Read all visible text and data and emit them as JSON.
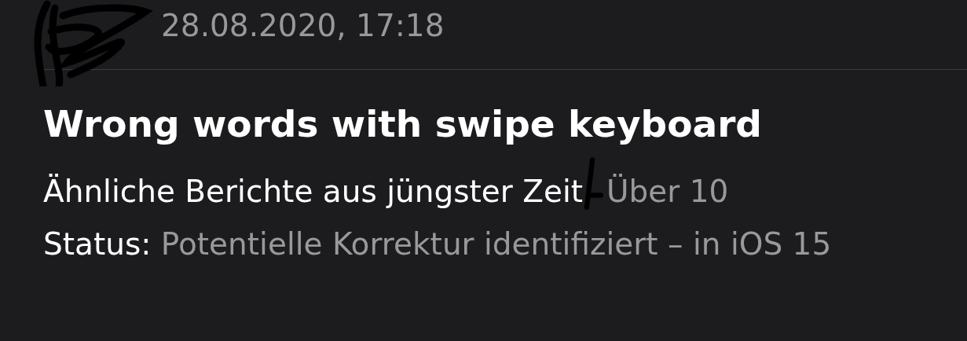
{
  "date": "28.08.2020, 17:18",
  "title": "Wrong words with swipe keyboard",
  "recent_reports": {
    "label": "Ähnliche Berichte aus jüngster Zeit",
    "value": "Über 10"
  },
  "status": {
    "label": "Status:",
    "value": "Potentielle Korrektur identifiziert – in iOS 15"
  }
}
